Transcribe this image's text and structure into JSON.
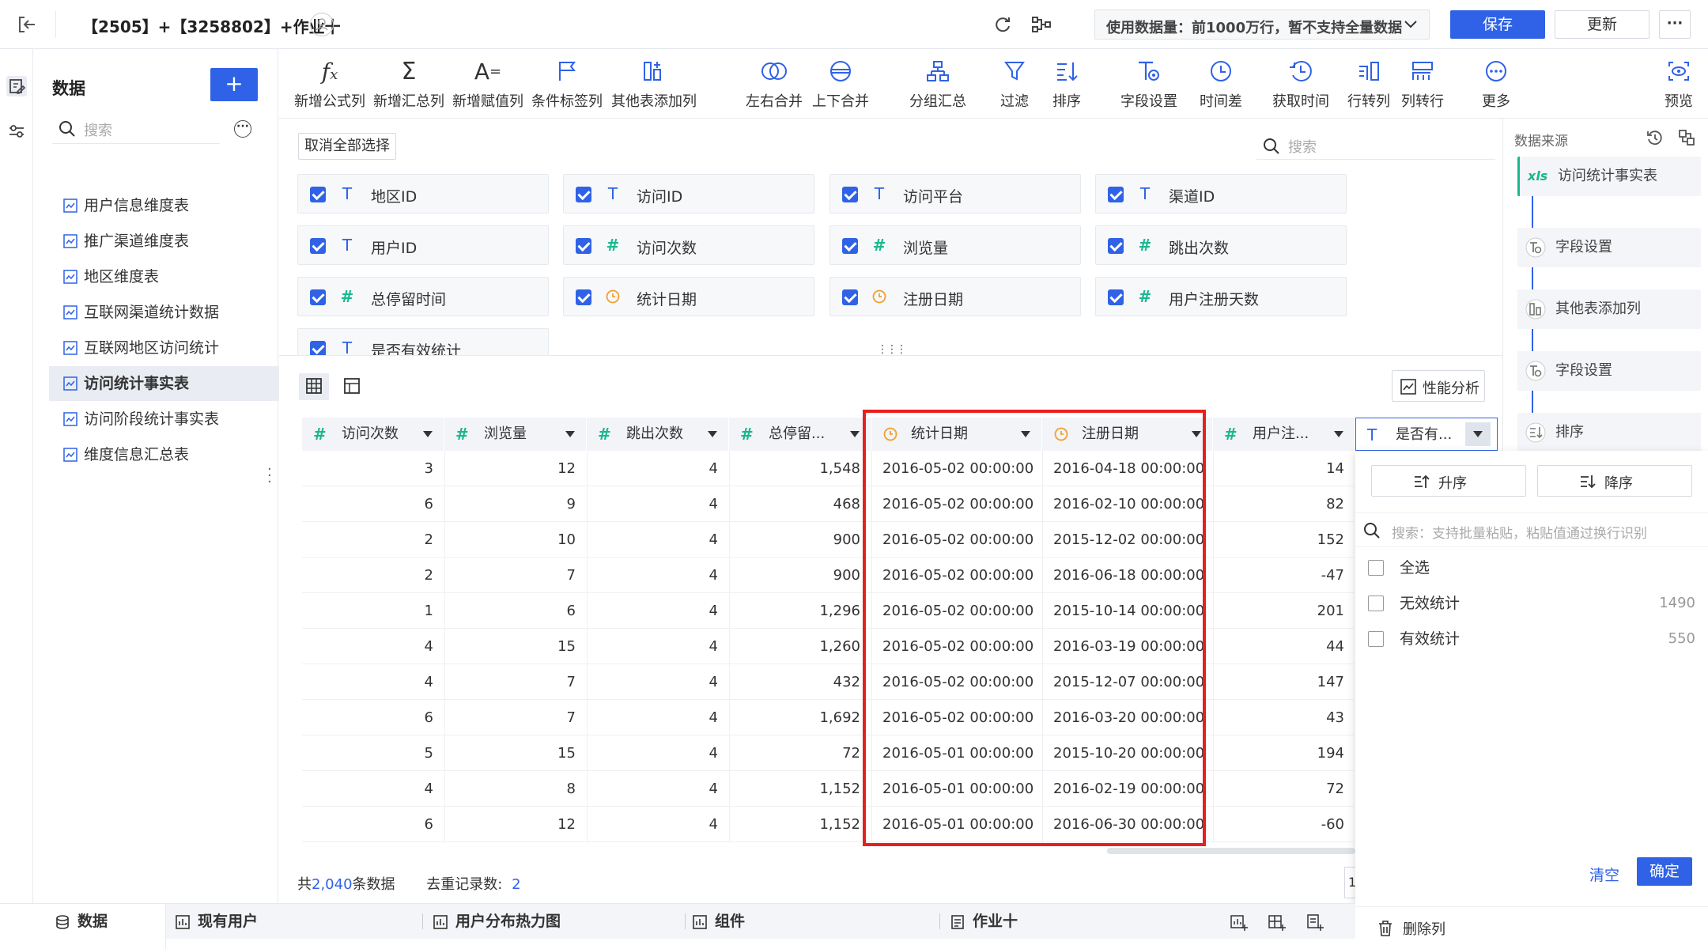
{
  "header": {
    "title": "【2505】+【3258802】+作业十",
    "data_usage": "使用数据量：前1000万行，暂不支持全量数据",
    "save_label": "保存",
    "update_label": "更新",
    "more_label": "···"
  },
  "sidebar": {
    "title": "数据",
    "add_label": "+",
    "search_placeholder": "搜索",
    "items": [
      {
        "label": "用户信息维度表"
      },
      {
        "label": "推广渠道维度表"
      },
      {
        "label": "地区维度表"
      },
      {
        "label": "互联网渠道统计数据"
      },
      {
        "label": "互联网地区访问统计"
      },
      {
        "label": "访问统计事实表"
      },
      {
        "label": "访问阶段统计事实表"
      },
      {
        "label": "维度信息汇总表"
      }
    ]
  },
  "toolbar": {
    "items": [
      {
        "label": "新增公式列",
        "icon": "fx-icon"
      },
      {
        "label": "新增汇总列",
        "icon": "sigma-icon"
      },
      {
        "label": "新增赋值列",
        "icon": "assign-icon"
      },
      {
        "label": "条件标签列",
        "icon": "flag-icon"
      },
      {
        "label": "其他表添加列",
        "icon": "add-column-icon"
      },
      {
        "label": "左右合并",
        "icon": "merge-lr-icon"
      },
      {
        "label": "上下合并",
        "icon": "merge-ud-icon"
      },
      {
        "label": "分组汇总",
        "icon": "group-icon"
      },
      {
        "label": "过滤",
        "icon": "filter-icon"
      },
      {
        "label": "排序",
        "icon": "sort-icon"
      },
      {
        "label": "字段设置",
        "icon": "field-settings-icon"
      },
      {
        "label": "时间差",
        "icon": "clock-icon"
      },
      {
        "label": "获取时间",
        "icon": "get-time-icon"
      },
      {
        "label": "行转列",
        "icon": "row-to-col-icon"
      },
      {
        "label": "列转行",
        "icon": "col-to-row-icon"
      },
      {
        "label": "更多",
        "icon": "more-icon"
      },
      {
        "label": "预览",
        "icon": "preview-icon"
      }
    ]
  },
  "fields": {
    "deselect_all": "取消全部选择",
    "search_placeholder": "搜索",
    "items": [
      {
        "type": "T",
        "name": "地区ID"
      },
      {
        "type": "T",
        "name": "访问ID"
      },
      {
        "type": "T",
        "name": "访问平台"
      },
      {
        "type": "T",
        "name": "渠道ID"
      },
      {
        "type": "T",
        "name": "用户ID"
      },
      {
        "type": "#",
        "name": "访问次数"
      },
      {
        "type": "#",
        "name": "浏览量"
      },
      {
        "type": "#",
        "name": "跳出次数"
      },
      {
        "type": "#",
        "name": "总停留时间"
      },
      {
        "type": "date",
        "name": "统计日期"
      },
      {
        "type": "date",
        "name": "注册日期"
      },
      {
        "type": "#",
        "name": "用户注册天数"
      },
      {
        "type": "T",
        "name": "是否有效统计"
      }
    ],
    "drag_handle": "⋮⋮⋮"
  },
  "table": {
    "perf_label": "性能分析",
    "headers": [
      "访问次数",
      "浏览量",
      "跳出次数",
      "总停留...",
      "统计日期",
      "注册日期",
      "用户注...",
      "是否有..."
    ],
    "rows": [
      [
        "3",
        "12",
        "4",
        "1,548",
        "2016-05-02 00:00:00",
        "2016-04-18 00:00:00",
        "14"
      ],
      [
        "6",
        "9",
        "4",
        "468",
        "2016-05-02 00:00:00",
        "2016-02-10 00:00:00",
        "82"
      ],
      [
        "2",
        "10",
        "4",
        "900",
        "2016-05-02 00:00:00",
        "2015-12-02 00:00:00",
        "152"
      ],
      [
        "2",
        "7",
        "4",
        "900",
        "2016-05-02 00:00:00",
        "2016-06-18 00:00:00",
        "-47"
      ],
      [
        "1",
        "6",
        "4",
        "1,296",
        "2016-05-02 00:00:00",
        "2015-10-14 00:00:00",
        "201"
      ],
      [
        "4",
        "15",
        "4",
        "1,260",
        "2016-05-02 00:00:00",
        "2016-03-19 00:00:00",
        "44"
      ],
      [
        "4",
        "7",
        "4",
        "432",
        "2016-05-02 00:00:00",
        "2015-12-07 00:00:00",
        "147"
      ],
      [
        "6",
        "7",
        "4",
        "1,692",
        "2016-05-02 00:00:00",
        "2016-03-20 00:00:00",
        "43"
      ],
      [
        "5",
        "15",
        "4",
        "72",
        "2016-05-01 00:00:00",
        "2015-10-20 00:00:00",
        "194"
      ],
      [
        "4",
        "8",
        "4",
        "1,152",
        "2016-05-01 00:00:00",
        "2016-02-19 00:00:00",
        "72"
      ],
      [
        "6",
        "12",
        "4",
        "1,152",
        "2016-05-01 00:00:00",
        "2016-06-30 00:00:00",
        "-60"
      ]
    ],
    "footer_total_prefix": "共",
    "footer_total": "2,040",
    "footer_total_suffix": "条数据",
    "footer_dedup_label": "去重记录数:",
    "footer_dedup": "2",
    "page_fragment": "1"
  },
  "right_panel": {
    "title": "数据来源",
    "source": "访问统计事实表",
    "source_badge": "xls",
    "nodes": [
      {
        "label": "字段设置"
      },
      {
        "label": "其他表添加列"
      },
      {
        "label": "字段设置"
      },
      {
        "label": "排序"
      }
    ]
  },
  "filter": {
    "asc_label": "升序",
    "desc_label": "降序",
    "search_placeholder": "搜索：支持批量粘贴，粘贴值通过换行识别",
    "select_all": "全选",
    "options": [
      {
        "label": "无效统计",
        "count": "1490"
      },
      {
        "label": "有效统计",
        "count": "550"
      }
    ],
    "clear_label": "清空",
    "confirm_label": "确定",
    "delete_label": "删除列"
  },
  "bottom_tabs": [
    {
      "label": "数据"
    },
    {
      "label": "现有用户"
    },
    {
      "label": "用户分布热力图"
    },
    {
      "label": "组件"
    },
    {
      "label": "作业十"
    }
  ],
  "colors": {
    "accent": "#2f62e6",
    "number_type": "#19b88e",
    "date_type": "#f0a030",
    "highlight": "#e8201d"
  }
}
